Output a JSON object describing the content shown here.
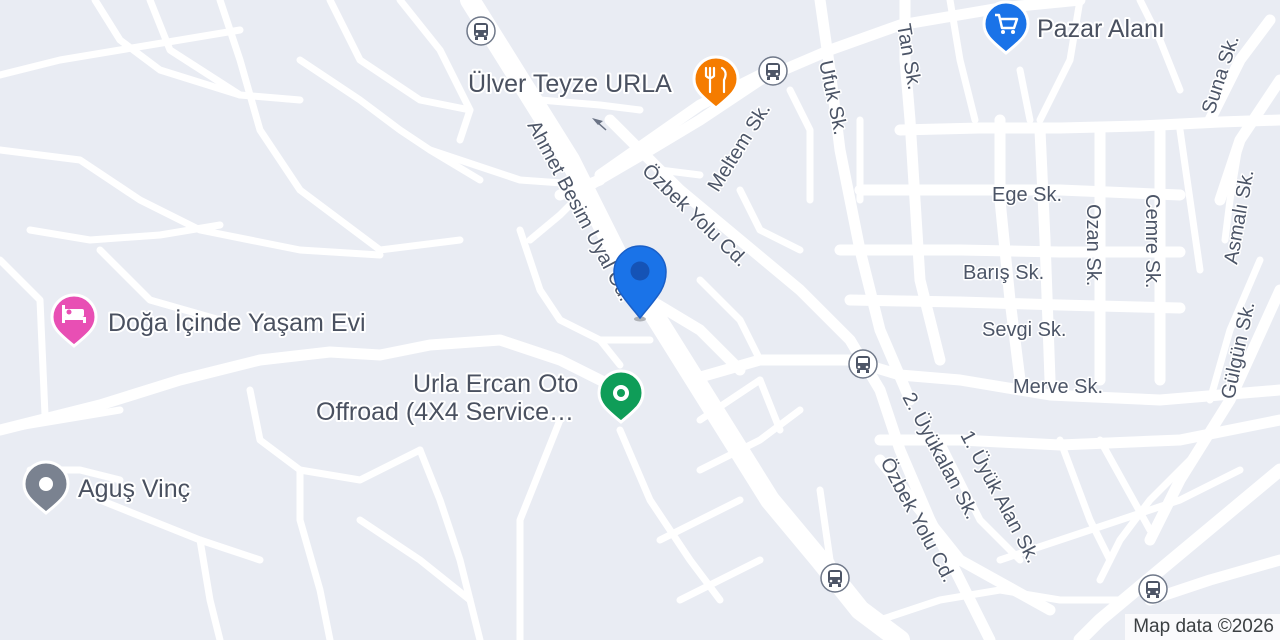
{
  "map": {
    "streets": {
      "ahmet_besim": "Ahmet Besim Uyal Cd.",
      "ozbek_yolu_1": "Özbek Yolu Cd.",
      "ozbek_yolu_2": "Özbek Yolu Cd.",
      "meltem": "Meltem Sk.",
      "ufuk": "Ufuk Sk.",
      "tan": "Tan Sk.",
      "suna": "Suna Sk.",
      "ege": "Ege Sk.",
      "baris": "Barış Sk.",
      "sevgi": "Sevgi Sk.",
      "merve": "Merve Sk.",
      "ozan": "Ozan Sk.",
      "cemre": "Cemre Sk.",
      "asmali": "Asmalı Sk.",
      "gulgun": "Gülgün Sk.",
      "uyukalan": "2. Üyükalan Sk.",
      "uyuk_alan": "1. Üyük Alan Sk."
    },
    "pois": {
      "pazar": {
        "label": "Pazar Alanı",
        "icon": "shopping-cart-icon",
        "color": "#1a73e8"
      },
      "ulver": {
        "label": "Ülver Teyze URLA",
        "icon": "restaurant-icon",
        "color": "#f57c00"
      },
      "doga": {
        "label": "Doğa İçinde Yaşam Evi",
        "icon": "hotel-bed-icon",
        "color": "#e84fb4"
      },
      "ercan": {
        "line1": "Urla Ercan Oto",
        "line2": "Offroad (4X4 Service…",
        "icon": "service-dot-icon",
        "color": "#0f9d58"
      },
      "agus": {
        "label": "Aguş Vinç",
        "icon": "place-icon",
        "color": "#7a8290"
      }
    },
    "transit_icon": "bus-stop-icon",
    "marker": {
      "icon": "location-pin-icon",
      "color": "#1a73e8"
    },
    "attribution": "Map data ©2026"
  }
}
